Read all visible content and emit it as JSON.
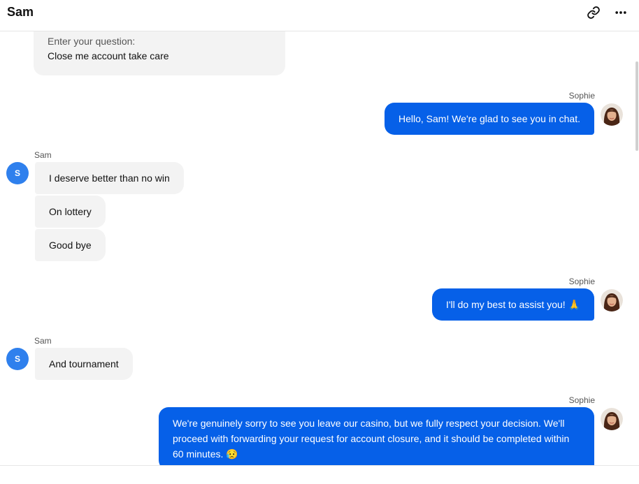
{
  "header": {
    "title": "Sam"
  },
  "form": {
    "label": "Enter your question:",
    "value": "Close me account take care"
  },
  "messages": [
    {
      "sender": "Sophie",
      "texts": [
        "Hello, Sam! We're glad to see you in chat."
      ]
    },
    {
      "sender": "Sam",
      "avatar": "S",
      "texts": [
        "I deserve better than no win",
        "On lottery",
        "Good bye"
      ]
    },
    {
      "sender": "Sophie",
      "texts": [
        "I'll do my best to assist you! 🙏"
      ]
    },
    {
      "sender": "Sam",
      "avatar": "S",
      "texts": [
        "And tournament"
      ]
    },
    {
      "sender": "Sophie",
      "texts": [
        "We're genuinely sorry to see you leave our casino, but we fully respect your decision. We'll proceed with forwarding your request for account closure, and it should be completed within 60 minutes. 😥"
      ]
    }
  ],
  "icons": {
    "link": "link-icon",
    "more": "more-horizontal-icon",
    "agent_avatar": "agent-avatar-photo"
  },
  "colors": {
    "agent_bubble": "#0660e8",
    "user_bubble": "#f3f3f3",
    "user_avatar": "#2f80ed"
  }
}
